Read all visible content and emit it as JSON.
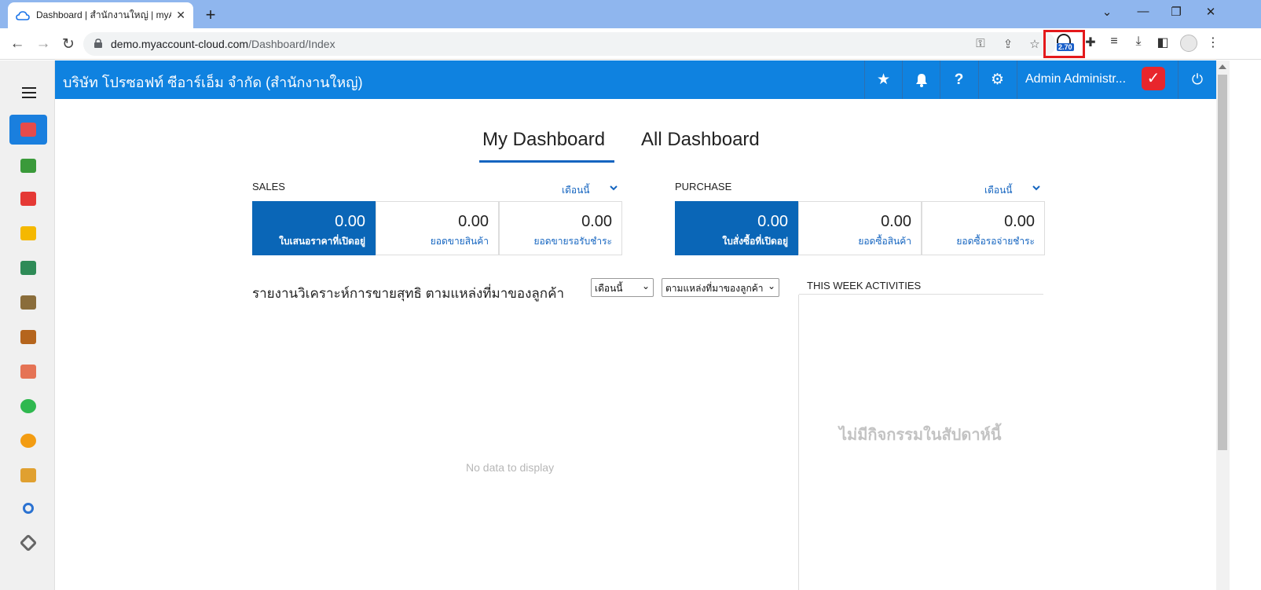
{
  "browser": {
    "tab_title": "Dashboard | สำนักงานใหญ่ | myAc",
    "url_host": "demo.myaccount-cloud.com",
    "url_path": "/Dashboard/Index",
    "extension_badge": "2.70"
  },
  "app": {
    "company_name": "บริษัท โปรซอฟท์ ซีอาร์เอ็ม จำกัด (สำนักงานใหญ่)",
    "user_name": "Admin Administr...",
    "brand_color": "#0f82e0"
  },
  "sidebar": {
    "items": [
      {
        "icon": "dashboard-icon",
        "color": "#e54b4b",
        "active": true
      },
      {
        "icon": "money-icon",
        "color": "#3a9a3a"
      },
      {
        "icon": "cart-icon",
        "color": "#e53935"
      },
      {
        "icon": "box-icon",
        "color": "#f5b800"
      },
      {
        "icon": "book-icon",
        "color": "#2e8b57"
      },
      {
        "icon": "bank-icon",
        "color": "#8a6d3b"
      },
      {
        "icon": "wallet-icon",
        "color": "#b5651d"
      },
      {
        "icon": "people-icon",
        "color": "#e57355"
      },
      {
        "icon": "check-icon",
        "color": "#2fb84f"
      },
      {
        "icon": "pie-chart-icon",
        "color": "#f39c12"
      },
      {
        "icon": "document-icon",
        "color": "#e0a030"
      },
      {
        "icon": "magnifier-icon",
        "color": "#2b72d1"
      },
      {
        "icon": "tools-icon",
        "color": "#666666"
      }
    ]
  },
  "dashboard": {
    "tabs": [
      "My Dashboard",
      "All Dashboard"
    ],
    "sales": {
      "title": "SALES",
      "period": "เดือนนี้",
      "cards": [
        {
          "value": "0.00",
          "label": "ใบเสนอราคาที่เปิดอยู่"
        },
        {
          "value": "0.00",
          "label": "ยอดขายสินค้า"
        },
        {
          "value": "0.00",
          "label": "ยอดขายรอรับชำระ"
        }
      ]
    },
    "purchase": {
      "title": "PURCHASE",
      "period": "เดือนนี้",
      "cards": [
        {
          "value": "0.00",
          "label": "ใบสั่งซื้อที่เปิดอยู่"
        },
        {
          "value": "0.00",
          "label": "ยอดซื้อสินค้า"
        },
        {
          "value": "0.00",
          "label": "ยอดซื้อรอจ่ายชำระ"
        }
      ]
    },
    "report": {
      "title": "รายงานวิเคราะห์การขายสุทธิ ตามแหล่งที่มาของลูกค้า",
      "period_select": "เดือนนี้",
      "source_select": "ตามแหล่งที่มาของลูกค้า",
      "empty_text": "No data to display"
    },
    "activities": {
      "title": "THIS WEEK ACTIVITIES",
      "empty_text": "ไม่มีกิจกรรมในสัปดาห์นี้"
    }
  }
}
